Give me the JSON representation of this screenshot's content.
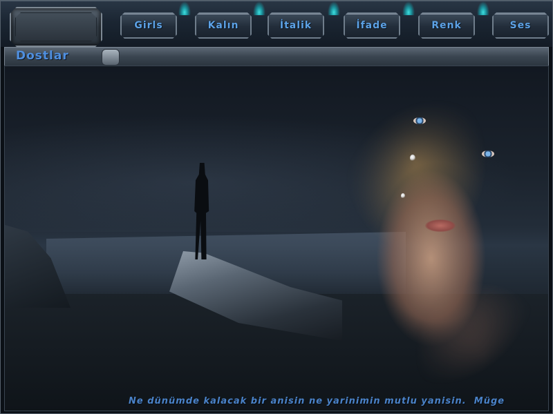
{
  "toolbar": {
    "buttons": [
      {
        "label": "Girls"
      },
      {
        "label": "Kalın"
      },
      {
        "label": "İtalik"
      },
      {
        "label": "İfade"
      },
      {
        "label": "Renk"
      },
      {
        "label": "Ses"
      }
    ]
  },
  "window": {
    "title": "Dostlar"
  },
  "caption": {
    "text": "Ne dünümde kalacak bir anisin ne yarinimin mutlu yanisin.  Müge"
  },
  "colors": {
    "accent_text": "#5da2e6",
    "caption_text": "#4a82c8",
    "chrome": "#3a4550"
  }
}
